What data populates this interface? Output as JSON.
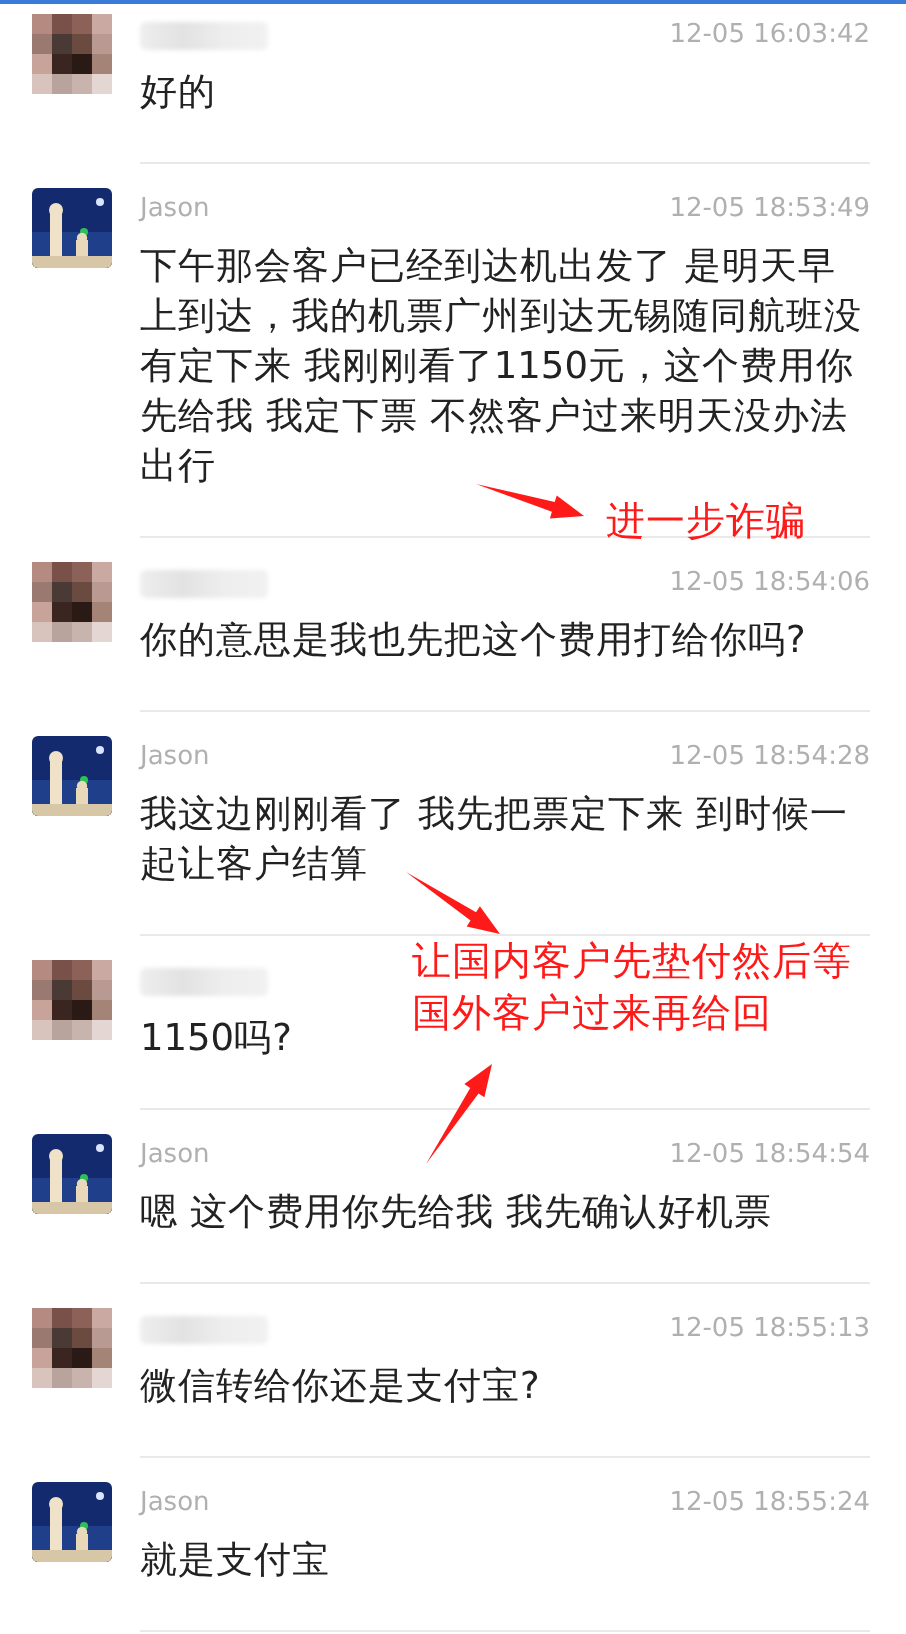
{
  "messages": [
    {
      "kind": "contact",
      "time": "12-05 16:03:42",
      "text": "好的"
    },
    {
      "kind": "named",
      "name": "Jason",
      "time": "12-05 18:53:49",
      "text": "下午那会客户已经到达机出发了 是明天早上到达，我的机票广州到达无锡随同航班没有定下来 我刚刚看了1150元，这个费用你先给我 我定下票 不然客户过来明天没办法出行"
    },
    {
      "kind": "contact",
      "time": "12-05 18:54:06",
      "text": "你的意思是我也先把这个费用打给你吗?"
    },
    {
      "kind": "named",
      "name": "Jason",
      "time": "12-05 18:54:28",
      "text": "我这边刚刚看了 我先把票定下来 到时候一起让客户结算"
    },
    {
      "kind": "contact",
      "text": "1150吗?"
    },
    {
      "kind": "named",
      "name": "Jason",
      "time": "12-05 18:54:54",
      "text": "嗯 这个费用你先给我 我先确认好机票"
    },
    {
      "kind": "contact",
      "time": "12-05 18:55:13",
      "text": "微信转给你还是支付宝?"
    },
    {
      "kind": "named",
      "name": "Jason",
      "time": "12-05 18:55:24",
      "text": "就是支付宝"
    }
  ],
  "annotations": [
    {
      "lines": [
        "进一步诈骗"
      ]
    },
    {
      "lines": [
        "让国内客户先垫付然后等",
        "国外客户过来再给回"
      ]
    }
  ]
}
